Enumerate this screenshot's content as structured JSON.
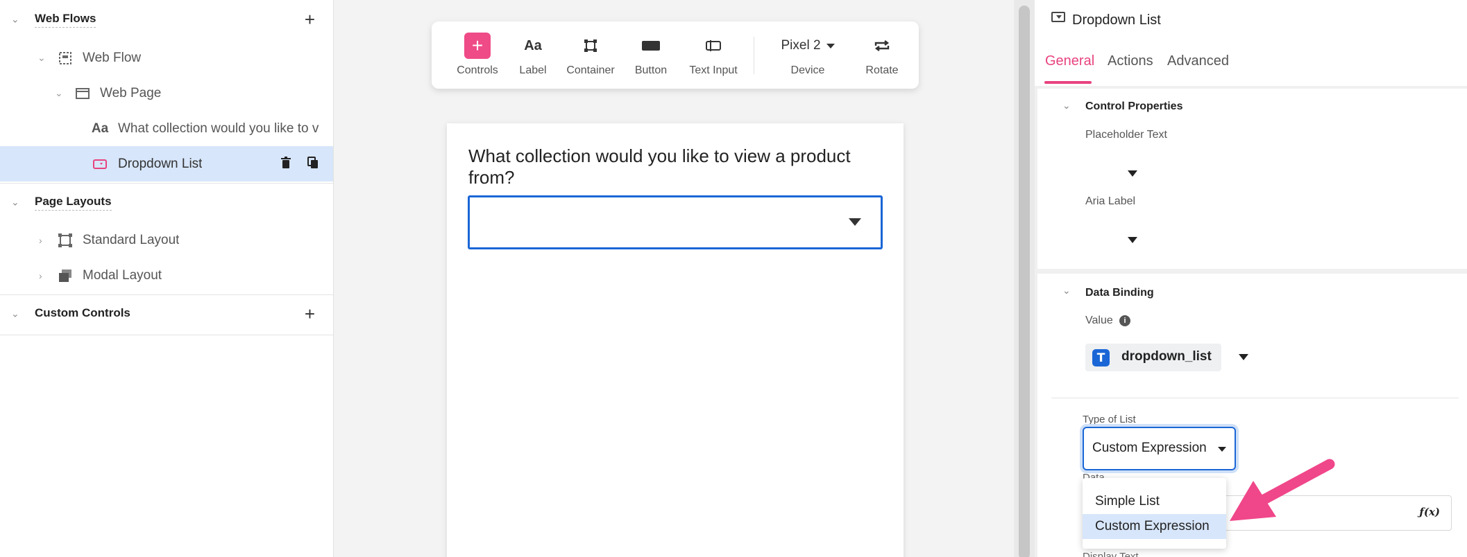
{
  "tree": {
    "web_flows": {
      "title": "Web Flows",
      "add_label": "+",
      "items": [
        {
          "label": "Web Flow"
        },
        {
          "label": "Web Page"
        },
        {
          "label": "What collection would you like to v"
        },
        {
          "label": "Dropdown List"
        }
      ]
    },
    "page_layouts": {
      "title": "Page Layouts",
      "items": [
        {
          "label": "Standard Layout"
        },
        {
          "label": "Modal Layout"
        }
      ]
    },
    "custom_controls": {
      "title": "Custom Controls",
      "add_label": "+"
    },
    "label_icon_text": "Aa"
  },
  "toolbar": {
    "controls_label": "Controls",
    "label_label": "Label",
    "label_icon_text": "Aa",
    "container_label": "Container",
    "button_label": "Button",
    "text_input_label": "Text Input",
    "device_value": "Pixel 2",
    "device_label": "Device",
    "rotate_label": "Rotate"
  },
  "phone": {
    "question": "What collection would you like to view a product from?"
  },
  "props": {
    "title": "Dropdown List",
    "tabs": [
      "General",
      "Actions",
      "Advanced"
    ],
    "active_tab": "General",
    "control_properties": {
      "title": "Control Properties",
      "placeholder_label": "Placeholder Text",
      "aria_label": "Aria Label"
    },
    "data_binding": {
      "title": "Data Binding",
      "value_label": "Value",
      "value": "dropdown_list",
      "type_label": "Type of List",
      "type_value": "Custom Expression",
      "data_label": "Data",
      "display_label": "Display Text",
      "options": [
        "Simple List",
        "Custom Expression"
      ],
      "highlighted_option": "Custom Expression"
    },
    "fx_label": "ƒ(x)"
  },
  "colors": {
    "accent_pink": "#e8437f",
    "focus_blue": "#1a66d6",
    "selection_bg": "#d7e6fa"
  }
}
